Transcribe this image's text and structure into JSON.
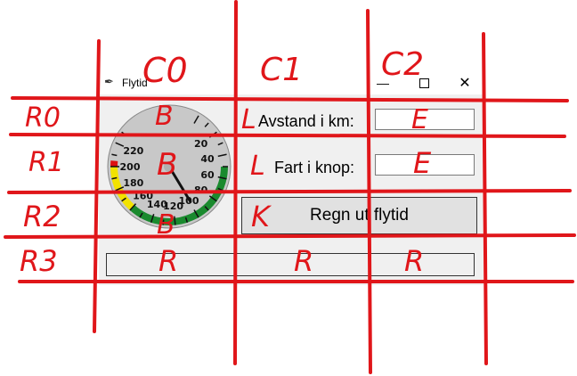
{
  "window": {
    "title": "Flytid",
    "icon": "feather-icon",
    "controls": {
      "minimize": "—",
      "maximize": "max-box",
      "close": "✕"
    }
  },
  "form": {
    "distance_label": "Avstand i km:",
    "speed_label": "Fart i knop:",
    "distance_value": "",
    "speed_value": "",
    "calculate_button": "Regn ut flytid",
    "result_text": ""
  },
  "gauge": {
    "ticks": [
      "20",
      "40",
      "60",
      "80",
      "100",
      "120",
      "140",
      "160",
      "180",
      "200",
      "220"
    ],
    "needle_value": 99,
    "colors": {
      "green": "#1a8a2e",
      "yellow": "#f2e200",
      "red": "#d11",
      "face": "#c8c8c8"
    }
  },
  "annotations": {
    "columns": [
      "C0",
      "C1",
      "C2"
    ],
    "rows": [
      "R0",
      "R1",
      "R2",
      "R3"
    ],
    "cells": [
      "B",
      "L",
      "E",
      "B",
      "L",
      "E",
      "B",
      "K",
      "R",
      "R",
      "R"
    ],
    "color": "#e0161a"
  }
}
